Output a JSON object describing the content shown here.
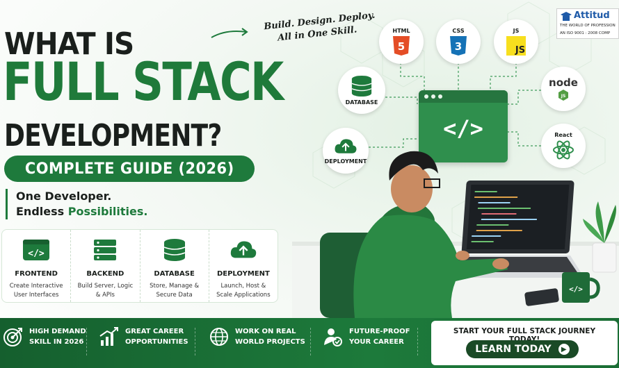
{
  "title": {
    "line1": "WHAT IS",
    "line2": "FULL STACK",
    "line3": "DEVELOPMENT?",
    "pill": "COMPLETE GUIDE (2026)"
  },
  "tagline": {
    "line1": "One Developer.",
    "line2_plain": "Endless ",
    "line2_accent": "Possibilities."
  },
  "slogan": {
    "line1": "Build. Design. Deploy.",
    "line2": "All in One Skill."
  },
  "cards": [
    {
      "title": "FRONTEND",
      "desc1": "Create Interactive",
      "desc2": "User Interfaces",
      "icon": "code-window-icon"
    },
    {
      "title": "BACKEND",
      "desc1": "Build Server, Logic",
      "desc2": "& APIs",
      "icon": "server-icon"
    },
    {
      "title": "DATABASE",
      "desc1": "Store, Manage &",
      "desc2": "Secure Data",
      "icon": "database-icon"
    },
    {
      "title": "DEPLOYMENT",
      "desc1": "Launch, Host &",
      "desc2": "Scale Applications",
      "icon": "cloud-upload-icon"
    }
  ],
  "tech": {
    "html": {
      "label": "HTML",
      "badge": "5"
    },
    "css": {
      "label": "CSS",
      "badge": "3"
    },
    "js": {
      "label": "JS",
      "badge": "JS"
    },
    "node": {
      "label": "node",
      "badge": "JS"
    },
    "react": {
      "label": "React"
    },
    "database": {
      "label": "DATABASE"
    },
    "deployment": {
      "label": "DEPLOYMENT"
    }
  },
  "code_window": {
    "tag": "</>"
  },
  "mug": {
    "tag": "</>"
  },
  "logo": {
    "brand": "Attitud",
    "line2": "THE WORLD OF PROFESSION",
    "line3": "AN ISO 9001 : 2008 COMP"
  },
  "perks": [
    {
      "line1": "HIGH DEMAND",
      "line2": "SKILL IN 2026",
      "icon": "target-icon"
    },
    {
      "line1": "GREAT CAREER",
      "line2": "OPPORTUNITIES",
      "icon": "growth-chart-icon"
    },
    {
      "line1": "WORK ON REAL",
      "line2": "WORLD PROJECTS",
      "icon": "globe-icon"
    },
    {
      "line1": "FUTURE-PROOF",
      "line2": "YOUR CAREER",
      "icon": "user-badge-icon"
    }
  ],
  "cta": {
    "title": "START YOUR FULL STACK JOURNEY TODAY!",
    "button": "LEARN TODAY",
    "button_icon": "arrow-right-icon"
  },
  "colors": {
    "brand_green": "#1e7a3c",
    "dark_green": "#155f2e",
    "text_dark": "#1a1f1c",
    "html_orange": "#e44d26",
    "css_blue": "#1572b6",
    "js_yellow": "#f7df1e",
    "node_green": "#539e43",
    "react_green": "#2f8f4d"
  }
}
